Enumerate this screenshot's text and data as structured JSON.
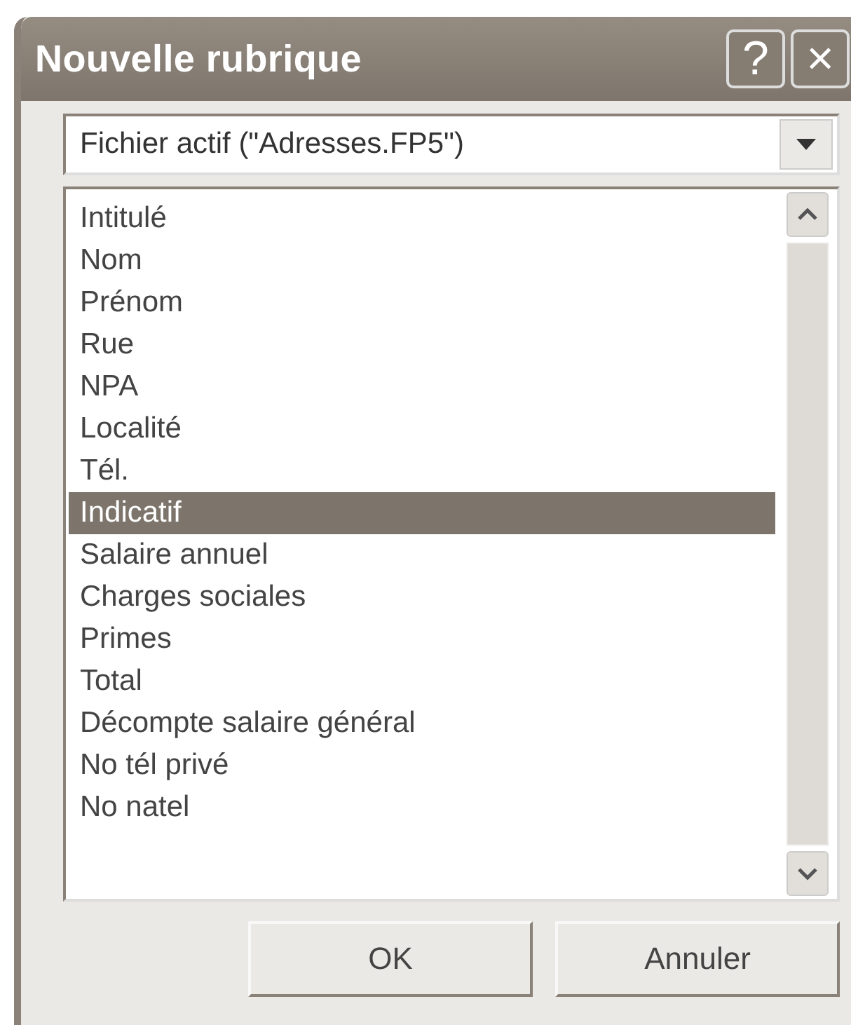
{
  "window": {
    "title": "Nouvelle rubrique",
    "title_buttons": [
      "?",
      "×"
    ]
  },
  "file_select": {
    "value": "Fichier actif (\"Adresses.FP5\")"
  },
  "fields": [
    {
      "label": "Intitulé",
      "selected": false
    },
    {
      "label": "Nom",
      "selected": false
    },
    {
      "label": "Prénom",
      "selected": false
    },
    {
      "label": "Rue",
      "selected": false
    },
    {
      "label": "NPA",
      "selected": false
    },
    {
      "label": "Localité",
      "selected": false
    },
    {
      "label": "Tél.",
      "selected": false
    },
    {
      "label": "Indicatif",
      "selected": true
    },
    {
      "label": "Salaire annuel",
      "selected": false
    },
    {
      "label": "Charges sociales",
      "selected": false
    },
    {
      "label": "Primes",
      "selected": false
    },
    {
      "label": "Total",
      "selected": false
    },
    {
      "label": "Décompte salaire général",
      "selected": false
    },
    {
      "label": "No tél privé",
      "selected": false
    },
    {
      "label": "No natel",
      "selected": false
    }
  ],
  "buttons": [
    "OK",
    "Annuler"
  ]
}
